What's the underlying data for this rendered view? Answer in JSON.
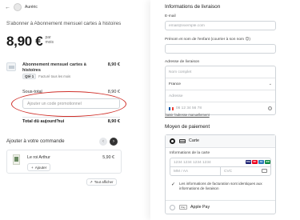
{
  "header": {
    "back_icon": "arrow-left-icon",
    "shop_name": "Auréric"
  },
  "summary": {
    "subscribe_title": "S'abonner à Abonnement mensuel cartes à histoires",
    "price": "8,90 €",
    "per_line1": "par",
    "per_line2": "mois",
    "item": {
      "name": "Abonnement mensuel cartes à histoires",
      "price": "8,90 €",
      "qty": "Qté 1",
      "billing": "Facturé tous les mois"
    },
    "subtotal_label": "Sous-total",
    "subtotal_value": "8,90 €",
    "promo_placeholder": "Ajouter un code promotionnel",
    "promo_annotation_color": "#d0302a",
    "total_label": "Total dû aujourd'hui",
    "total_value": "8,90 €"
  },
  "upsell": {
    "title": "Ajouter à votre commande",
    "prev_icon": "chevron-left-icon",
    "next_icon": "chevron-right-icon",
    "product_name": "Le roi Arthur",
    "product_price": "5,90 €",
    "add_plus": "+",
    "add_label": "Ajouter",
    "show_all_icon": "expand-icon",
    "show_all_label": "Tout afficher"
  },
  "shipping": {
    "section_title": "Informations de livraison",
    "email_label": "E-mail",
    "email_placeholder": "email@exemple.com",
    "child_name_label": "Prénom et nom de l'enfant (courrier à son nom 😊)",
    "address_label": "Adresse de livraison",
    "full_name_placeholder": "Nom complet",
    "country_value": "France",
    "address_placeholder": "Adresse",
    "phone_placeholder": "06 12 34 56 78",
    "manual_link": "Saisir l'adresse manuellement",
    "info_icon": "info-icon"
  },
  "payment": {
    "section_title": "Moyen de paiement",
    "card_label": "Carte",
    "card_info_label": "Informations de la carte",
    "card_number_placeholder": "1234 1234 1234 1234",
    "expiry_placeholder": "MM / AA",
    "cvc_placeholder": "CVC",
    "brands": [
      {
        "name": "VISA",
        "color": "#1a1f71"
      },
      {
        "name": "MC",
        "color": "#eb001b"
      },
      {
        "name": "AX",
        "color": "#2e77bb"
      },
      {
        "name": "JCB",
        "color": "#0b8a3e"
      }
    ],
    "same_billing_check": "✓",
    "same_billing_text": "Les informations de facturation sont identiques aux informations de livraison",
    "apple_pay_badge": "Pay",
    "apple_pay_label": "Apple Pay"
  }
}
